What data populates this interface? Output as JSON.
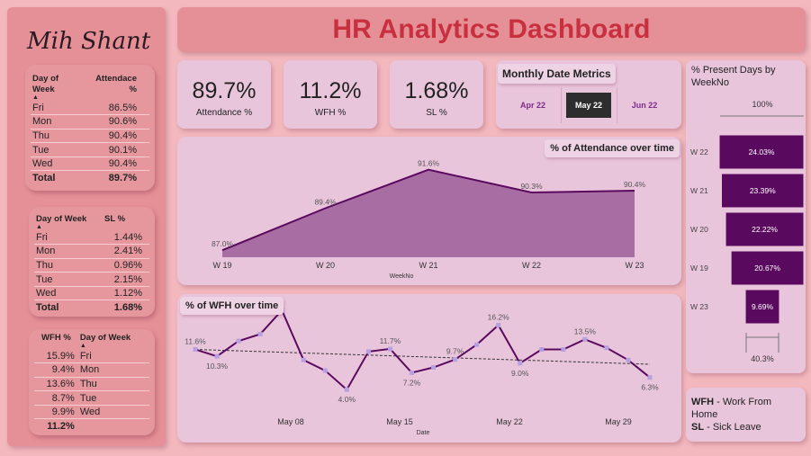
{
  "dashboard_title": "HR Analytics Dashboard",
  "author": "Mih Shanto",
  "colors": {
    "accent": "#5a0a5e",
    "area_fill": "#a86ea4",
    "title": "#c8303f",
    "panel": "#e9c5dc",
    "sidebar": "#e58f96"
  },
  "attendance_table": {
    "headers": [
      "Day of Week",
      "Attendace %"
    ],
    "rows": [
      {
        "day": "Fri",
        "value": "86.5%"
      },
      {
        "day": "Mon",
        "value": "90.6%"
      },
      {
        "day": "Thu",
        "value": "90.4%"
      },
      {
        "day": "Tue",
        "value": "90.1%"
      },
      {
        "day": "Wed",
        "value": "90.4%"
      }
    ],
    "total_label": "Total",
    "total_value": "89.7%"
  },
  "sl_table": {
    "headers": [
      "Day of Week",
      "SL %"
    ],
    "rows": [
      {
        "day": "Fri",
        "value": "1.44%"
      },
      {
        "day": "Mon",
        "value": "2.41%"
      },
      {
        "day": "Thu",
        "value": "0.96%"
      },
      {
        "day": "Tue",
        "value": "2.15%"
      },
      {
        "day": "Wed",
        "value": "1.12%"
      }
    ],
    "total_label": "Total",
    "total_value": "1.68%"
  },
  "wfh_table": {
    "headers": [
      "WFH %",
      "Day of Week"
    ],
    "rows": [
      {
        "value": "15.9%",
        "day": "Fri"
      },
      {
        "value": "9.4%",
        "day": "Mon"
      },
      {
        "value": "13.6%",
        "day": "Thu"
      },
      {
        "value": "8.7%",
        "day": "Tue"
      },
      {
        "value": "9.9%",
        "day": "Wed"
      }
    ],
    "total_value": "11.2%"
  },
  "kpis": [
    {
      "value": "89.7%",
      "label": "Attendance %"
    },
    {
      "value": "11.2%",
      "label": "WFH %"
    },
    {
      "value": "1.68%",
      "label": "SL %"
    }
  ],
  "slicer": {
    "title": "Monthly Date Metrics",
    "options": [
      "Apr 22",
      "May 22",
      "Jun 22"
    ],
    "selected": "May 22"
  },
  "legend_notes": [
    {
      "abbr": "WFH",
      "text": " - Work From Home"
    },
    {
      "abbr": "SL",
      "text": " - Sick Leave"
    }
  ],
  "chart_data": [
    {
      "type": "area",
      "title": "% of Attendance over time",
      "xlabel": "WeekNo",
      "categories": [
        "W 19",
        "W 20",
        "W 21",
        "W 22",
        "W 23"
      ],
      "values": [
        87.0,
        89.4,
        91.6,
        90.3,
        90.4
      ],
      "data_labels": [
        "87.0%",
        "89.4%",
        "91.6%",
        "90.3%",
        "90.4%"
      ],
      "ylim": [
        86.6,
        92.2
      ]
    },
    {
      "type": "line",
      "title": "% of WFH over time",
      "xlabel": "Date",
      "x_ticks": [
        "May 08",
        "May 15",
        "May 22",
        "May 29"
      ],
      "x": [
        "May 02",
        "May 03",
        "May 04",
        "May 05",
        "May 06",
        "May 09",
        "May 10",
        "May 11",
        "May 12",
        "May 13",
        "May 16",
        "May 17",
        "May 18",
        "May 19",
        "May 20",
        "May 23",
        "May 24",
        "May 25",
        "May 26",
        "May 27",
        "May 30",
        "May 31"
      ],
      "values": [
        11.6,
        10.3,
        13.2,
        14.5,
        19.0,
        9.6,
        7.6,
        4.0,
        11.2,
        11.7,
        7.2,
        8.2,
        9.7,
        12.5,
        16.2,
        9.0,
        11.6,
        11.6,
        13.5,
        11.9,
        9.6,
        6.3
      ],
      "data_labels": [
        {
          "index": 0,
          "text": "11.6%"
        },
        {
          "index": 1,
          "text": "10.3%"
        },
        {
          "index": 7,
          "text": "4.0%"
        },
        {
          "index": 9,
          "text": "11.7%"
        },
        {
          "index": 10,
          "text": "7.2%"
        },
        {
          "index": 12,
          "text": "9.7%"
        },
        {
          "index": 14,
          "text": "16.2%"
        },
        {
          "index": 15,
          "text": "9.0%"
        },
        {
          "index": 18,
          "text": "13.5%"
        },
        {
          "index": 21,
          "text": "6.3%"
        }
      ],
      "trendline": {
        "start": 11.6,
        "end": 8.8,
        "style": "dashed"
      },
      "ylim": [
        2,
        19
      ]
    },
    {
      "type": "bar",
      "orientation": "horizontal",
      "title": "% Present Days by WeekNo",
      "categories": [
        "W 22",
        "W 21",
        "W 20",
        "W 19",
        "W 23"
      ],
      "values": [
        24.03,
        23.39,
        22.22,
        20.67,
        9.69
      ],
      "data_labels": [
        "24.03%",
        "23.39%",
        "22.22%",
        "20.67%",
        "9.69%"
      ],
      "top_label": "100%",
      "bottom_label": "40.3%",
      "xlim": [
        0,
        24.03
      ]
    }
  ]
}
